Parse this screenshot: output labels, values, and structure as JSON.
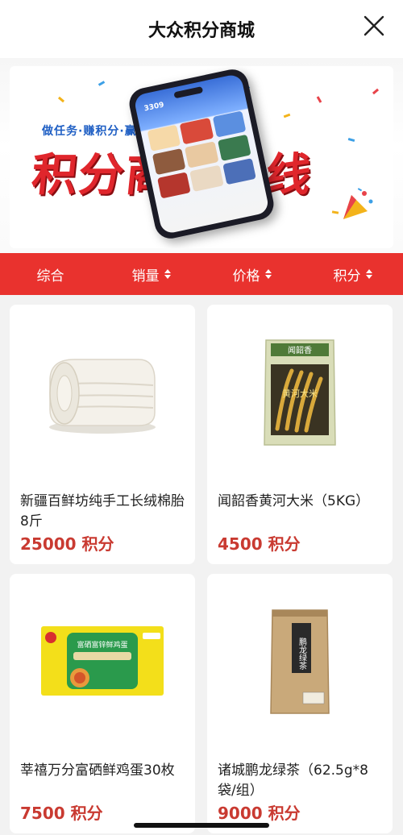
{
  "header": {
    "title": "大众积分商城",
    "close_icon": "close-icon"
  },
  "banner": {
    "slogan": "做任务·赚积分·赢礼品",
    "headline": "积分商城上线",
    "phone_points": "3309",
    "accent_color": "#e0262c"
  },
  "filter_bar": {
    "background": "#e9322e",
    "items": [
      {
        "label": "综合",
        "sortable": false
      },
      {
        "label": "销量",
        "sortable": true
      },
      {
        "label": "价格",
        "sortable": true
      },
      {
        "label": "积分",
        "sortable": true
      }
    ]
  },
  "products": [
    {
      "name": "新疆百鲜坊纯手工长绒棉胎8斤",
      "price": "25000 积分",
      "icon": "quilt-image"
    },
    {
      "name": "闻韶香黄河大米（5KG）",
      "price": "4500 积分",
      "icon": "rice-bag-image"
    },
    {
      "name": "莘禧万分富硒鲜鸡蛋30枚",
      "price": "7500 积分",
      "icon": "egg-box-image"
    },
    {
      "name": "诸城鹏龙绿茶（62.5g*8袋/组）",
      "price": "9000 积分",
      "icon": "tea-bag-image"
    }
  ],
  "product_images": {
    "rice_bag_brand": "闻韶香",
    "rice_bag_text": "黄河大米",
    "egg_box_title": "富硒富锌鲜鸡蛋",
    "tea_bag_text": "鹏龙绿茶"
  }
}
